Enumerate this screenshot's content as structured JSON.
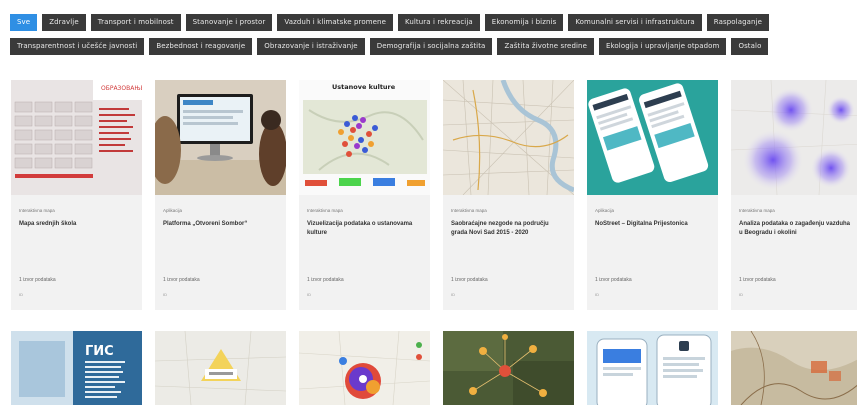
{
  "filters": {
    "row1": [
      "Sve",
      "Zdravlje",
      "Transport i mobilnost",
      "Stanovanje i prostor",
      "Vazduh i klimatske promene",
      "Kultura i rekreacija",
      "Ekonomija i biznis",
      "Komunalni servisi i infrastruktura",
      "Raspolaganje"
    ],
    "row2": [
      "Transparentnost i učešće javnosti",
      "Bezbednost i reagovanje",
      "Obrazovanje i istraživanje",
      "Demografija i socijalna zaštita",
      "Zaštita životne sredine",
      "Ekologija i upravljanje otpadom",
      "Ostalo"
    ],
    "active_color": "#2f8fe4",
    "chip_color": "#3a3a3a"
  },
  "cards": [
    {
      "meta": "Interaktivna mapa",
      "title": "Mapa srednjih škola",
      "count": "1 izvor podataka",
      "tiny": "ID"
    },
    {
      "meta": "Aplikacija",
      "title": "Platforma „Otvoreni Sombor“",
      "count": "1 izvor podataka",
      "tiny": "ID"
    },
    {
      "meta": "Interaktivna mapa",
      "title": "Vizuelizacija podataka o ustanovama kulture",
      "count": "1 izvor podataka",
      "tiny": "ID",
      "thumb_caption": "Ustanove kulture"
    },
    {
      "meta": "Interaktivna mapa",
      "title": "Saobraćajne nezgode na području grada Novi Sad 2015 - 2020",
      "count": "1 izvor podataka",
      "tiny": "ID"
    },
    {
      "meta": "Aplikacija",
      "title": "NoStreet – Digitalna Prijestonica",
      "count": "1 izvor podataka",
      "tiny": "ID"
    },
    {
      "meta": "Interaktivna mapa",
      "title": "Analiza podataka o zagađenju vazduha u Beogradu i okolini",
      "count": "1 izvor podataka",
      "tiny": "ID"
    }
  ],
  "row2": [
    {
      "label": "ГИС"
    },
    {
      "label": ""
    },
    {
      "label": ""
    },
    {
      "label": ""
    },
    {
      "label": ""
    },
    {
      "label": ""
    }
  ]
}
